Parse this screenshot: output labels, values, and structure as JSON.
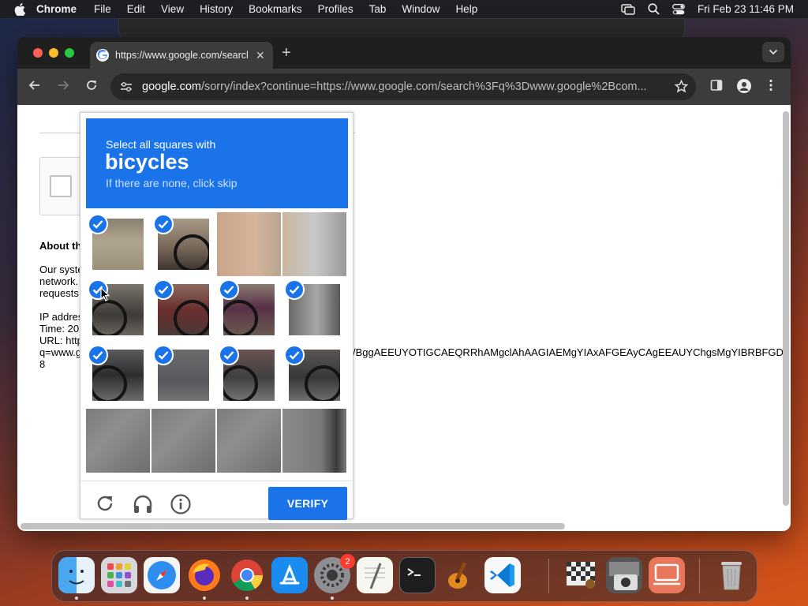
{
  "menubar": {
    "app_name": "Chrome",
    "items": [
      "File",
      "Edit",
      "View",
      "History",
      "Bookmarks",
      "Profiles",
      "Tab",
      "Window",
      "Help"
    ],
    "clock": "Fri Feb 23  11:46 PM"
  },
  "browser": {
    "tab_title": "https://www.google.com/search?q",
    "url_host": "google.com",
    "url_path": "/sorry/index?continue=https://www.google.com/search%3Fq%3Dwww.google%2Bcom..."
  },
  "page": {
    "about_heading": "About th",
    "para_line1": "Our syste",
    "para_line2": "network.",
    "para_line3": "requests",
    "ip_line": "IP addres",
    "time_line": "Time: 20",
    "url_line": "URL: http",
    "q_line_start": "q=www.g",
    "q_line_end": "/BggAEEUYOTIGCAEQRRhAMgclAhAAGIAEMgYIAxAFGEAyCAgEEAUYChgsMgYIBRBFGD",
    "last_line": "8"
  },
  "captcha": {
    "instruction": "Select all squares with",
    "target": "bicycles",
    "hint": "If there are none, click skip",
    "verify_label": "VERIFY",
    "tiles": [
      {
        "selected": true,
        "scene": "wall"
      },
      {
        "selected": true,
        "scene": "handlebar"
      },
      {
        "selected": false,
        "scene": "wall-bright"
      },
      {
        "selected": false,
        "scene": "wall-machine"
      },
      {
        "selected": true,
        "scene": "wheel-left"
      },
      {
        "selected": true,
        "scene": "bike-frame"
      },
      {
        "selected": true,
        "scene": "bike-seat"
      },
      {
        "selected": true,
        "scene": "bike-rear"
      },
      {
        "selected": true,
        "scene": "wheel-bottom"
      },
      {
        "selected": true,
        "scene": "ground"
      },
      {
        "selected": true,
        "scene": "wheel-mid"
      },
      {
        "selected": true,
        "scene": "wheel-right"
      },
      {
        "selected": false,
        "scene": "pavement"
      },
      {
        "selected": false,
        "scene": "pavement"
      },
      {
        "selected": false,
        "scene": "pavement"
      },
      {
        "selected": false,
        "scene": "pavement-curb"
      }
    ]
  },
  "dock": {
    "apps": [
      "finder",
      "launchpad",
      "safari",
      "firefox",
      "chrome",
      "app-store",
      "system-settings",
      "textedit",
      "terminal",
      "garageband",
      "vscode",
      "chess",
      "image-capture",
      "screen-sharing",
      "trash"
    ],
    "settings_badge": "2"
  },
  "colors": {
    "accent": "#1a73e8",
    "window_bg": "#1f1f1f"
  }
}
